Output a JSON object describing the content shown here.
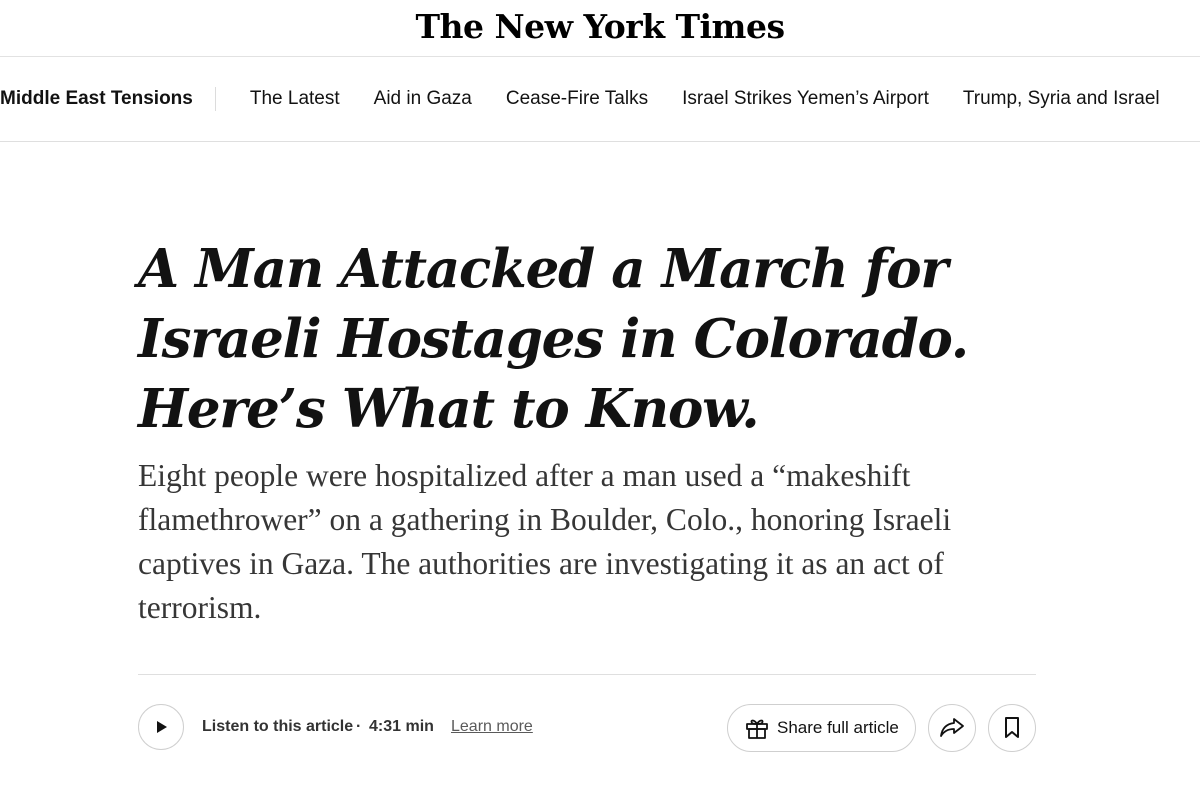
{
  "masthead": {
    "logo_text": "The New York Times"
  },
  "section_nav": {
    "title": "Middle East Tensions",
    "items": [
      {
        "label": "The Latest"
      },
      {
        "label": "Aid in Gaza"
      },
      {
        "label": "Cease-Fire Talks"
      },
      {
        "label": "Israel Strikes Yemen’s Airport"
      },
      {
        "label": "Trump, Syria and Israel"
      }
    ]
  },
  "article": {
    "headline": "A Man Attacked a March for Israeli Hostages in Colorado. Here’s What to Know.",
    "summary": "Eight people were hospitalized after a man used a “makeshift flamethrower” on a gathering in Boulder, Colo., honoring Israeli captives in Gaza. The authorities are investigating it as an act of terrorism."
  },
  "toolbar": {
    "listen_label": "Listen to this article",
    "separator": "·",
    "duration": "4:31 min",
    "learn_more": "Learn more",
    "share_full": "Share full article",
    "icons": {
      "play": "play-icon",
      "gift": "gift-icon",
      "share": "share-arrow-icon",
      "save": "bookmark-icon"
    }
  },
  "colors": {
    "text": "#121212",
    "summary_text": "#363636",
    "border": "#dfdfdf"
  }
}
